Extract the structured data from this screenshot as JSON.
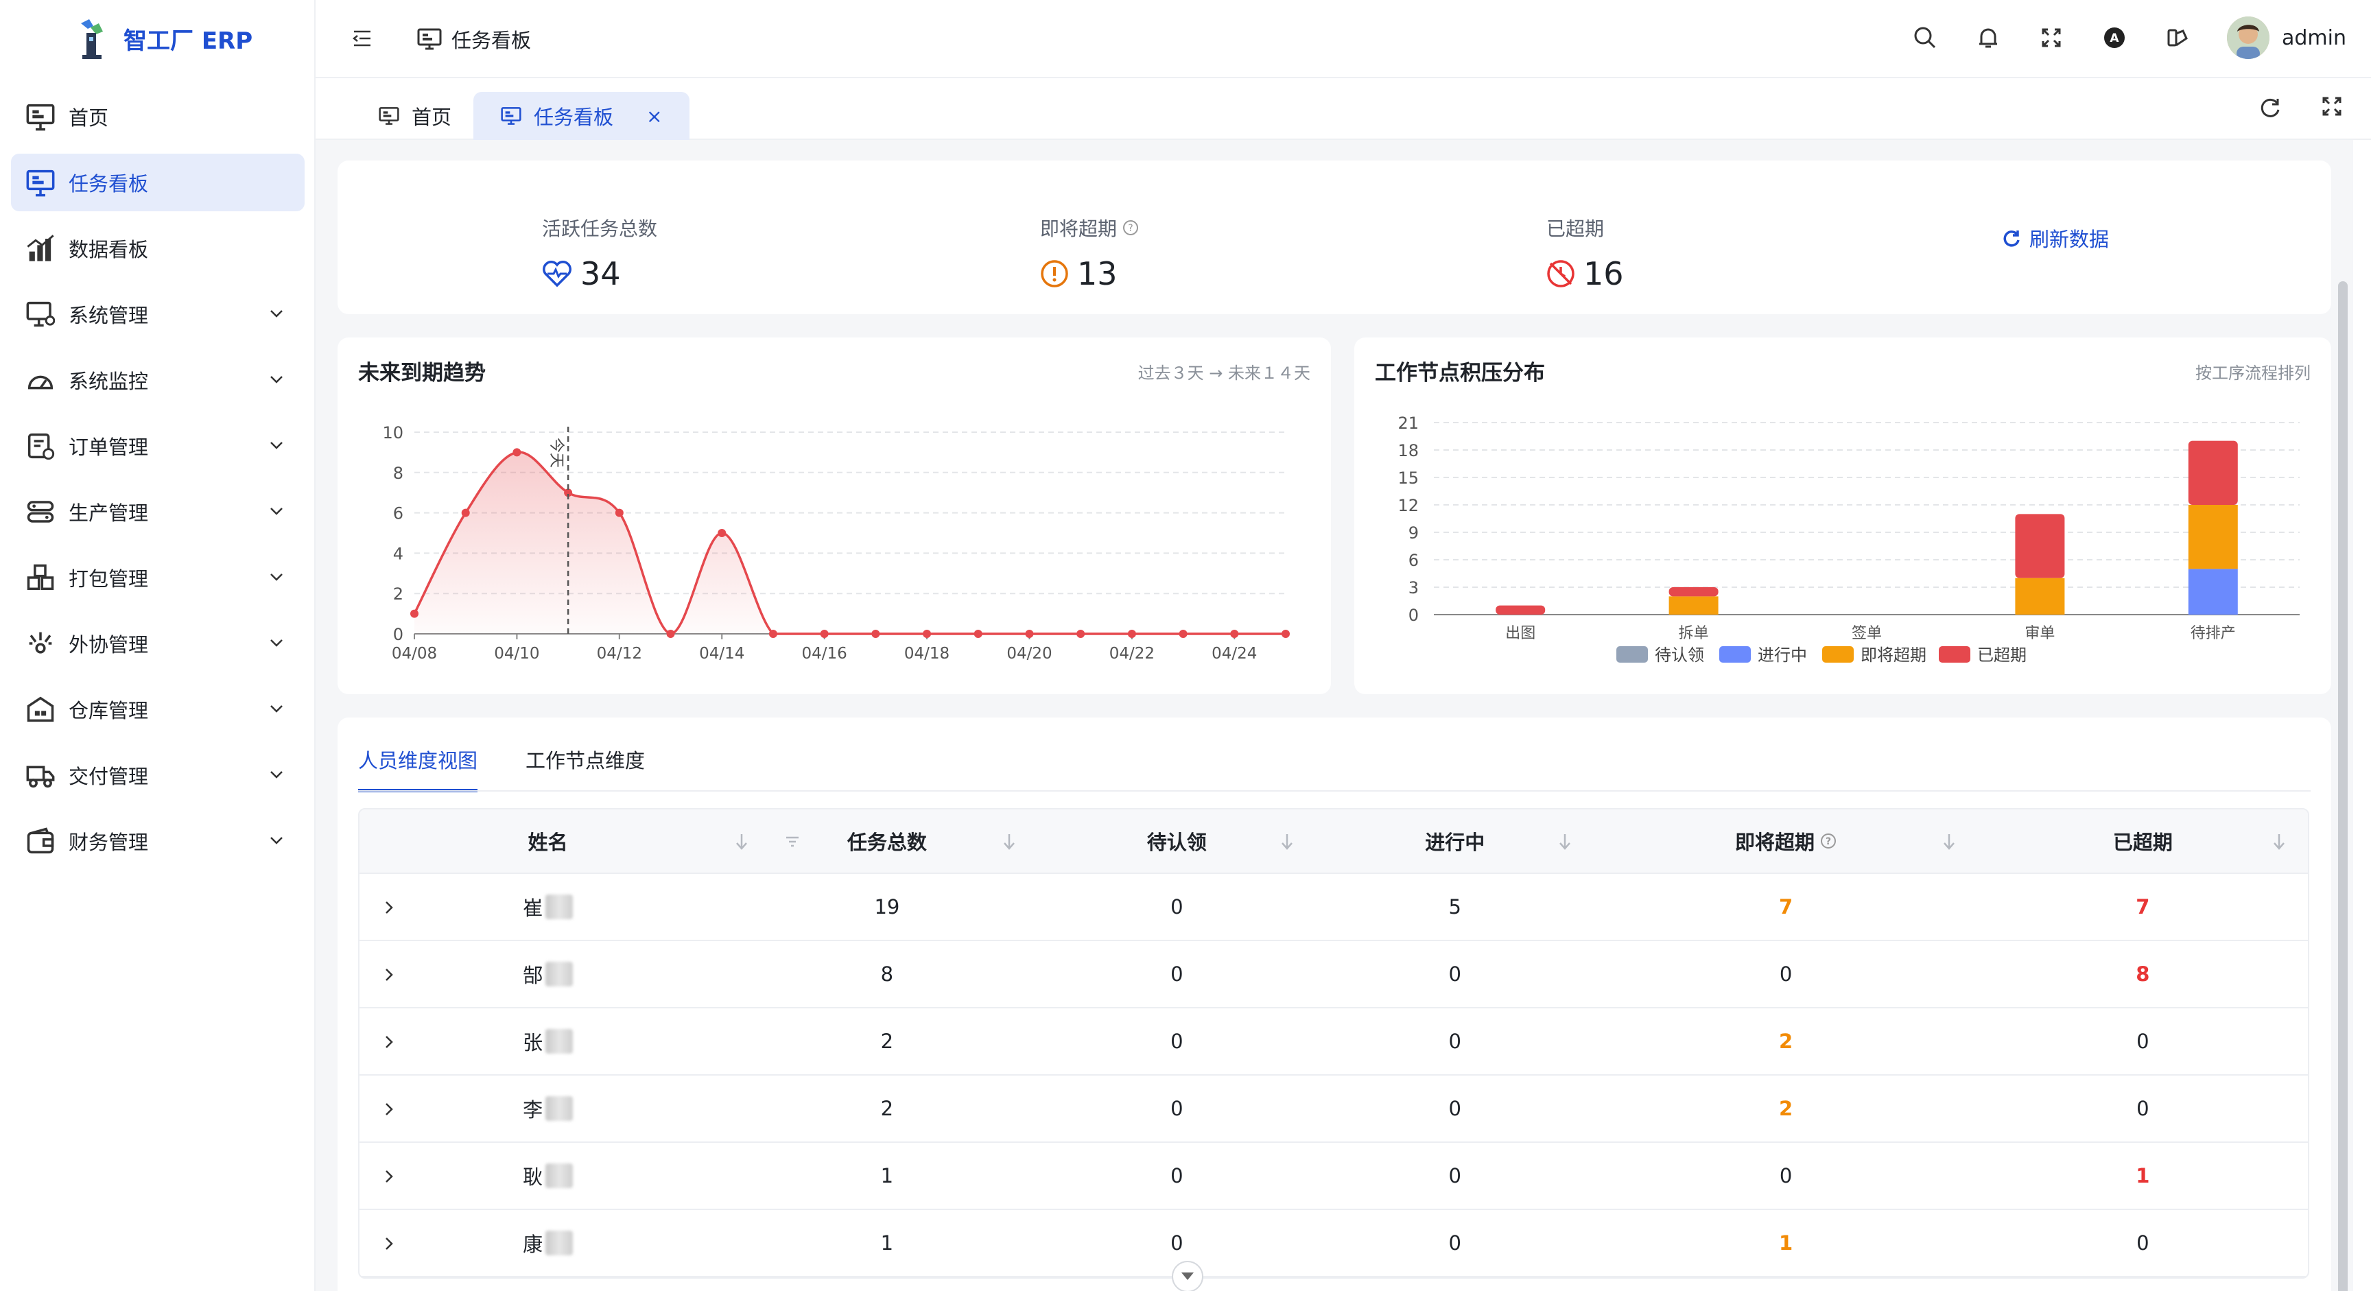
{
  "app": {
    "name": "智工厂 ERP",
    "username": "admin"
  },
  "sidebar": {
    "items": [
      {
        "label": "首页",
        "icon": "monitor-icon",
        "active": false,
        "expandable": false
      },
      {
        "label": "任务看板",
        "icon": "monitor-icon",
        "active": true,
        "expandable": false
      },
      {
        "label": "数据看板",
        "icon": "bar-chart-icon",
        "active": false,
        "expandable": false
      },
      {
        "label": "系统管理",
        "icon": "computer-settings-icon",
        "active": false,
        "expandable": true
      },
      {
        "label": "系统监控",
        "icon": "gauge-icon",
        "active": false,
        "expandable": true
      },
      {
        "label": "订单管理",
        "icon": "order-icon",
        "active": false,
        "expandable": true
      },
      {
        "label": "生产管理",
        "icon": "production-icon",
        "active": false,
        "expandable": true
      },
      {
        "label": "打包管理",
        "icon": "package-icon",
        "active": false,
        "expandable": true
      },
      {
        "label": "外协管理",
        "icon": "outsource-icon",
        "active": false,
        "expandable": true
      },
      {
        "label": "仓库管理",
        "icon": "warehouse-icon",
        "active": false,
        "expandable": true
      },
      {
        "label": "交付管理",
        "icon": "truck-icon",
        "active": false,
        "expandable": true
      },
      {
        "label": "财务管理",
        "icon": "wallet-icon",
        "active": false,
        "expandable": true
      }
    ]
  },
  "header": {
    "breadcrumb": "任务看板"
  },
  "tabs": [
    {
      "label": "首页"
    },
    {
      "label": "任务看板",
      "active": true,
      "close": "×"
    }
  ],
  "stats": {
    "active": {
      "label": "活跃任务总数",
      "value": "34"
    },
    "soon": {
      "label": "即将超期",
      "value": "13"
    },
    "overdue": {
      "label": "已超期",
      "value": "16"
    },
    "refresh": "刷新数据"
  },
  "charts": {
    "trend": {
      "title": "未来到期趋势",
      "subtitle": "过去３天 → 未来１４天",
      "today": "今天"
    },
    "backlog": {
      "title": "工作节点积压分布",
      "subtitle": "按工序流程排列"
    }
  },
  "chart_data": [
    {
      "type": "area",
      "title": "未来到期趋势",
      "x": [
        "04/08",
        "04/09",
        "04/10",
        "04/11",
        "04/12",
        "04/13",
        "04/14",
        "04/15",
        "04/16",
        "04/17",
        "04/18",
        "04/19",
        "04/20",
        "04/21",
        "04/22",
        "04/23",
        "04/24",
        "04/25"
      ],
      "x_tick_labels": [
        "04/08",
        "04/10",
        "04/12",
        "04/14",
        "04/16",
        "04/18",
        "04/20",
        "04/22",
        "04/24"
      ],
      "series": [
        {
          "values": [
            1,
            6,
            9,
            7,
            6,
            0,
            5,
            0,
            0,
            0,
            0,
            0,
            0,
            0,
            0,
            0,
            0,
            0
          ]
        }
      ],
      "ylim": [
        0,
        10
      ],
      "yticks": [
        0,
        2,
        4,
        6,
        8,
        10
      ],
      "marker_line": {
        "x": "04/11",
        "label": "今天"
      },
      "color": "#e5484d"
    },
    {
      "type": "bar",
      "stacked": true,
      "title": "工作节点积压分布",
      "categories": [
        "出图",
        "拆单",
        "签单",
        "审单",
        "待排产"
      ],
      "series": [
        {
          "name": "待认领",
          "color": "#94a3b8",
          "values": [
            0,
            0,
            0,
            0,
            0
          ]
        },
        {
          "name": "进行中",
          "color": "#6b8afd",
          "values": [
            0,
            0,
            0,
            0,
            5
          ]
        },
        {
          "name": "即将超期",
          "color": "#f59e0b",
          "values": [
            0,
            2,
            0,
            4,
            7
          ]
        },
        {
          "name": "已超期",
          "color": "#e5484d",
          "values": [
            1,
            1,
            0,
            7,
            7
          ]
        }
      ],
      "ylim": [
        0,
        21
      ],
      "yticks": [
        0,
        3,
        6,
        9,
        12,
        15,
        18,
        21
      ],
      "legend": "bottom"
    }
  ],
  "table": {
    "tabs": [
      "人员维度视图",
      "工作节点维度"
    ],
    "columns": [
      "姓名",
      "任务总数",
      "待认领",
      "进行中",
      "即将超期",
      "已超期"
    ],
    "rows": [
      {
        "name": "崔",
        "total": "19",
        "pending": "0",
        "progress": "5",
        "soon": "7",
        "overdue": "7"
      },
      {
        "name": "郜",
        "total": "8",
        "pending": "0",
        "progress": "0",
        "soon": "0",
        "overdue": "8"
      },
      {
        "name": "张",
        "total": "2",
        "pending": "0",
        "progress": "0",
        "soon": "2",
        "overdue": "0"
      },
      {
        "name": "李",
        "total": "2",
        "pending": "0",
        "progress": "0",
        "soon": "2",
        "overdue": "0"
      },
      {
        "name": "耿",
        "total": "1",
        "pending": "0",
        "progress": "0",
        "soon": "0",
        "overdue": "1"
      },
      {
        "name": "康",
        "total": "1",
        "pending": "0",
        "progress": "0",
        "soon": "1",
        "overdue": "0"
      }
    ]
  }
}
